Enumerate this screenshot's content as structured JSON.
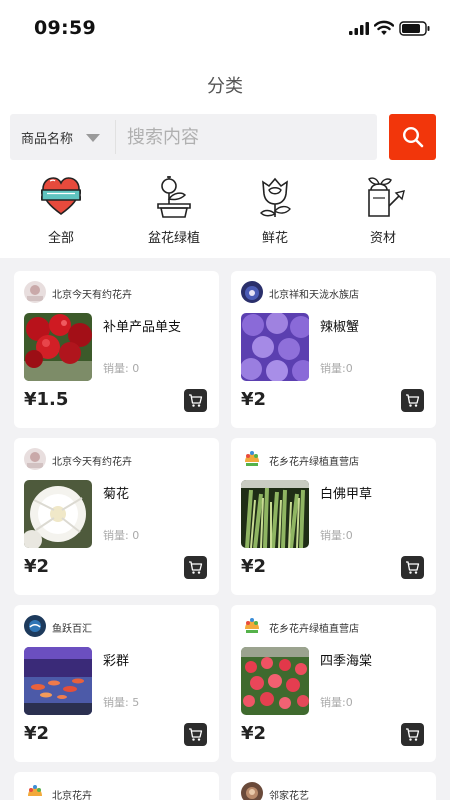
{
  "status_bar": {
    "time": "09:59"
  },
  "header": {
    "title": "分类"
  },
  "search": {
    "filter_label": "商品名称",
    "placeholder": "搜索内容"
  },
  "categories": [
    {
      "label": "全部",
      "icon": "heart-ribbon-icon"
    },
    {
      "label": "盆花绿植",
      "icon": "potted-plant-icon"
    },
    {
      "label": "鲜花",
      "icon": "rose-icon"
    },
    {
      "label": "资材",
      "icon": "watering-can-icon"
    }
  ],
  "products": [
    {
      "shop": "北京今天有约花卉",
      "name": "补单产品单支",
      "sales": "销量: 0",
      "price": "¥1.5"
    },
    {
      "shop": "北京祥和天泷水族店",
      "name": "辣椒蟹",
      "sales": "销量:0",
      "price": "¥2"
    },
    {
      "shop": "北京今天有约花卉",
      "name": "菊花",
      "sales": "销量: 0",
      "price": "¥2"
    },
    {
      "shop": "花乡花卉绿植直营店",
      "name": "白佛甲草",
      "sales": "销量:0",
      "price": "¥2"
    },
    {
      "shop": "鱼跃百汇",
      "name": "彩群",
      "sales": "销量: 5",
      "price": "¥2"
    },
    {
      "shop": "花乡花卉绿植直营店",
      "name": "四季海棠",
      "sales": "销量:0",
      "price": "¥2"
    },
    {
      "shop": "北京花卉"
    },
    {
      "shop": "邻家花艺"
    }
  ],
  "colors": {
    "accent": "#f2360b",
    "page_bg": "#f2f2f4",
    "card_bg": "#ffffff",
    "cart_button": "#2c2c2c"
  }
}
